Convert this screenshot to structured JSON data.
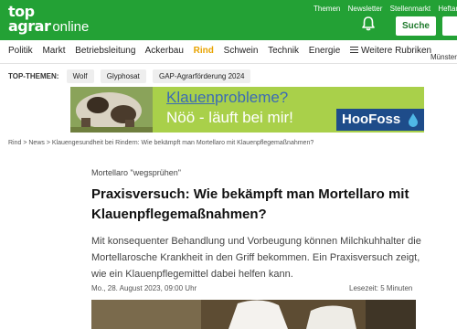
{
  "header": {
    "logo_top": "top",
    "logo_main": "agrar",
    "logo_suffix": "online",
    "links": [
      "Themen",
      "Newsletter",
      "Stellenmarkt",
      "Heftarchiv"
    ],
    "search_label": "Suche",
    "brand_color": "#23a135"
  },
  "nav": {
    "items": [
      "Politik",
      "Markt",
      "Betriebsleitung",
      "Ackerbau",
      "Rind",
      "Schwein",
      "Technik",
      "Energie"
    ],
    "active": "Rind",
    "more_label": "Weitere Rubriken",
    "region_label": "Münster"
  },
  "top_themes": {
    "label": "TOP-THEMEN:",
    "chips": [
      "Wolf",
      "Glyphosat",
      "GAP-Agrarförderung 2024"
    ]
  },
  "ad": {
    "line1_underlined": "Klauen",
    "line1_rest": "probleme?",
    "line2": "Nöö - läuft bei mir!",
    "brand": "HooFoss"
  },
  "breadcrumb": "Rind > News > Klauengesundheit bei Rindern: Wie bekämpft man Mortellaro mit Klauenpflegemaßnahmen?",
  "article": {
    "kicker": "Mortellaro \"wegsprühen\"",
    "headline": "Praxisversuch: Wie bekämpft man Mortellaro mit Klau­en­pflegemaßnahmen?",
    "lead": "Mit konsequenter Behandlung und Vorbeugung können Milchkuhhalter die Mortellarosche Krankheit in den Griff bekommen. Ein Praxisversuch zeigt, wie ein Klauenpflegemittel dabei helfen kann.",
    "date": "Mo., 28. August 2023, 09:00 Uhr",
    "read_time": "Lesezeit: 5 Minuten"
  }
}
